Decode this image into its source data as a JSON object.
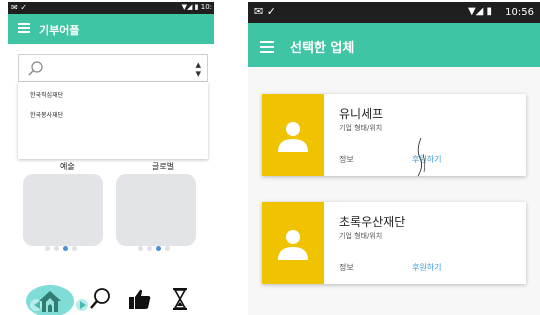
{
  "left_screen": {
    "status_bar": {
      "left_icons": "mail-icon, check-icon",
      "right_text": "10:"
    },
    "app_bar": {
      "title": "기부어플"
    },
    "search": {
      "value": "",
      "placeholder": ""
    },
    "dropdown": {
      "options": [
        "한국직심재단",
        "한국봉사재단"
      ]
    },
    "categories": [
      {
        "label": "예술",
        "dots": 4,
        "active_dot": 3
      },
      {
        "label": "글로벌",
        "dots": 4,
        "active_dot": 3
      }
    ],
    "bottom_nav": [
      "home-icon",
      "search-icon",
      "thumbs-up-icon",
      "hourglass-icon"
    ]
  },
  "right_screen": {
    "status_bar": {
      "time": "10:56"
    },
    "app_bar": {
      "title": "선택한 업체"
    },
    "companies": [
      {
        "name": "유니세프",
        "type": "기업 형태/위치",
        "info": "정보",
        "sponsor": "후원하기"
      },
      {
        "name": "초록우산재단",
        "type": "기업 형태/위치",
        "info": "정보",
        "sponsor": "후원하기"
      }
    ]
  },
  "colors": {
    "accent": "#3fc5a3",
    "thumb": "#f0c300",
    "link": "#3a9bdc",
    "active_dot": "#4a90d9"
  }
}
